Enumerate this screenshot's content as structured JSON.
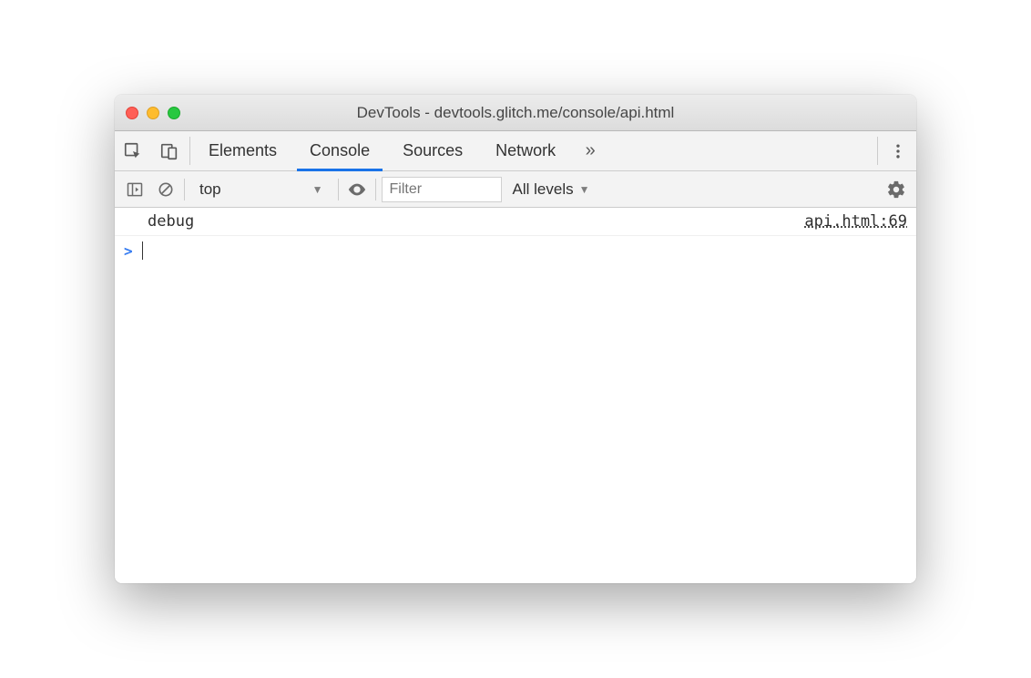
{
  "window": {
    "title": "DevTools - devtools.glitch.me/console/api.html"
  },
  "tabs": {
    "items": [
      "Elements",
      "Console",
      "Sources",
      "Network"
    ],
    "active_index": 1
  },
  "toolbar": {
    "context": "top",
    "filter_placeholder": "Filter",
    "levels_label": "All levels"
  },
  "console": {
    "rows": [
      {
        "message": "debug",
        "source": "api.html:69"
      }
    ],
    "prompt": ">"
  }
}
